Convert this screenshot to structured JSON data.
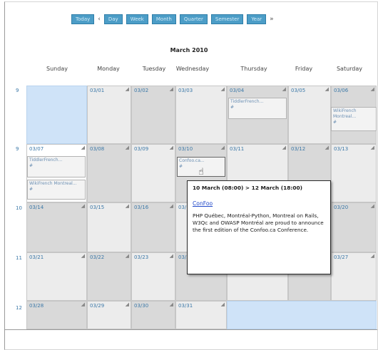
{
  "toolbar": {
    "today": "Today",
    "prev": "‹",
    "day": "Day",
    "week": "Week",
    "month": "Month",
    "quarter": "Quarter",
    "semester": "Semester",
    "year": "Year",
    "next": "»"
  },
  "calendar": {
    "title": "March 2010",
    "weekdays": [
      "Sunday",
      "Monday",
      "Tuesday",
      "Wednesday",
      "Thursday",
      "Friday",
      "Saturday"
    ],
    "week_numbers": [
      "9",
      "9",
      "10",
      "11",
      "12"
    ],
    "rows": [
      [
        "",
        "03/01",
        "03/02",
        "03/03",
        "03/04",
        "03/05",
        "03/06"
      ],
      [
        "03/07",
        "03/08",
        "03/09",
        "03/10",
        "03/11",
        "03/12",
        "03/13"
      ],
      [
        "03/14",
        "03/15",
        "03/16",
        "03/17",
        "",
        "",
        "03/20"
      ],
      [
        "03/21",
        "03/22",
        "03/23",
        "03/24",
        "",
        "",
        "03/27"
      ],
      [
        "03/28",
        "03/29",
        "03/30",
        "03/31",
        "",
        "",
        ""
      ]
    ]
  },
  "events": {
    "thu_first": "TiddlerFrench...",
    "sat_first": "WikiFrench Montreal...",
    "sun_second_a": "TiddlerFrench...",
    "sun_second_b": "WikiFrench Montreal...",
    "wed_confoo": "Confoo.ca...",
    "mark": "#"
  },
  "popup": {
    "title": "10 March (08:00) > 12 March (18:00)",
    "link": "ConFoo",
    "description": "PHP Québec, Montréal-Python, Montreal on Rails, W3Qc and OWASP Montréal are proud to announce the first edition of the Confoo.ca Conference."
  },
  "colors": {
    "button": "#4c9dc7",
    "today_cell": "#cfe3f8",
    "weekend_cell": "#d9d9d9",
    "link": "#1e46c8"
  }
}
